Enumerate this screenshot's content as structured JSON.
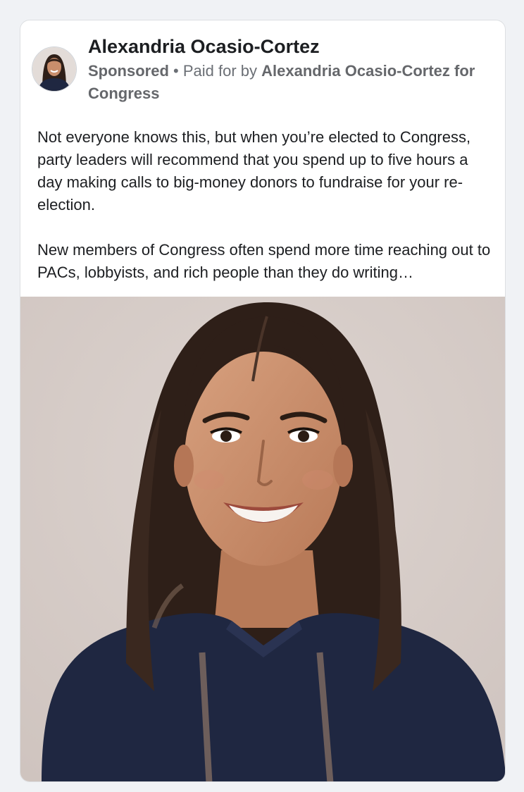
{
  "post": {
    "author_name": "Alexandria Ocasio-Cortez",
    "sponsored_label": "Sponsored",
    "separator": "•",
    "paid_for_prefix": "Paid for by",
    "paid_for_entity": "Alexandria Ocasio-Cortez for Congress",
    "paragraph_1": "Not everyone knows this, but when you’re elected to Congress, party leaders will recommend that you spend up to five hours a day making calls to big-money donors to fundraise for your re-election.",
    "paragraph_2": "New members of Congress often spend more time reaching out to PACs, lobbyists, and rich people than they do writing…"
  },
  "colors": {
    "photo_background": "#d6ccc8",
    "hair": "#2e1f18",
    "skin": "#c98e6c",
    "top": "#1f2741",
    "text_primary": "#1c1e21",
    "text_secondary": "#65676b"
  },
  "icons": {
    "avatar": "profile-photo",
    "ad_image": "portrait-photo"
  }
}
